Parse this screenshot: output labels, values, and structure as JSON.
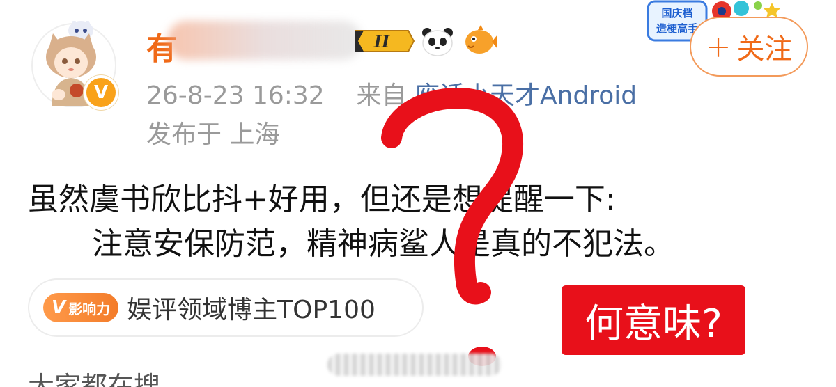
{
  "author": {
    "name_visible": "有",
    "verified_badge": "V",
    "level_badge": "II",
    "emojis": [
      "panda-icon",
      "pufferfish-icon"
    ]
  },
  "sticker": {
    "line1": "国庆档",
    "line2": "造梗高手"
  },
  "follow": {
    "plus": "+",
    "label": "关注"
  },
  "meta": {
    "datetime": "26-8-23 16:32",
    "from_label": "来自",
    "source": "废话小天才Android",
    "location": "发布于 上海"
  },
  "post": {
    "line1": "虽然虞书欣比抖+好用，但还是想提醒一下:",
    "line2": "注意安保防范，精神病鲨人是真的不犯法。"
  },
  "influence": {
    "badge_v": "V",
    "badge_text": "影响力",
    "text": "娱评领域博主TOP100"
  },
  "overlay": {
    "question_label": "何意味?"
  },
  "trending": {
    "title": "大家都在搜"
  },
  "colors": {
    "accent_orange": "#f06a18",
    "source_blue": "#4a6fa5",
    "overlay_red": "#e8101a",
    "meta_gray": "#9a9a9a"
  }
}
